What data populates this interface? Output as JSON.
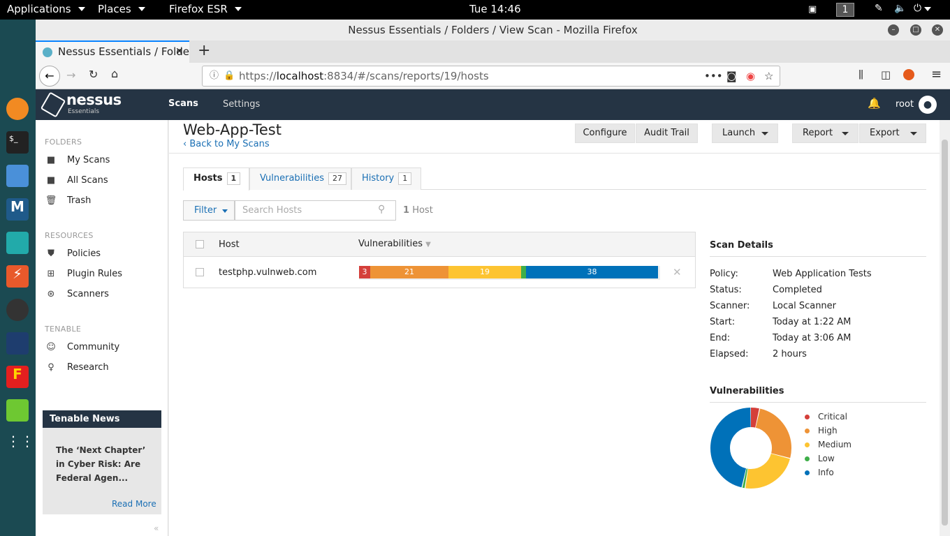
{
  "gnome": {
    "applications": "Applications",
    "places": "Places",
    "browser": "Firefox ESR",
    "clock": "Tue 14:46",
    "workspace": "1"
  },
  "window": {
    "title": "Nessus Essentials / Folders / View Scan - Mozilla Firefox",
    "tab_title": "Nessus Essentials / Folders",
    "url_prefix": "https://",
    "url_host": "localhost",
    "url_rest": ":8834/#/scans/reports/19/hosts"
  },
  "nessus": {
    "logo_text": "nessus",
    "logo_sub": "Essentials",
    "nav_scans": "Scans",
    "nav_settings": "Settings",
    "user": "root"
  },
  "sidebar": {
    "folders_header": "FOLDERS",
    "my_scans": "My Scans",
    "all_scans": "All Scans",
    "trash": "Trash",
    "resources_header": "RESOURCES",
    "policies": "Policies",
    "plugin_rules": "Plugin Rules",
    "scanners": "Scanners",
    "tenable_header": "TENABLE",
    "community": "Community",
    "research": "Research",
    "news_title": "Tenable News",
    "news_body": "The ‘Next Chapter’ in Cyber Risk: Are Federal Agen...",
    "read_more": "Read More"
  },
  "scan": {
    "title": "Web-App-Test",
    "back": "Back to My Scans",
    "configure": "Configure",
    "audit_trail": "Audit Trail",
    "launch": "Launch",
    "report": "Report",
    "export": "Export"
  },
  "tabs": {
    "hosts_label": "Hosts",
    "hosts_count": "1",
    "vulns_label": "Vulnerabilities",
    "vulns_count": "27",
    "history_label": "History",
    "history_count": "1"
  },
  "filter": {
    "label": "Filter",
    "search_placeholder": "Search Hosts",
    "host_count": "1",
    "host_count_label": "Host"
  },
  "table": {
    "col_host": "Host",
    "col_vulns": "Vulnerabilities",
    "rows": [
      {
        "host": "testphp.vulnweb.com",
        "critical": "3",
        "high": "21",
        "medium": "19",
        "low": "",
        "info": "38"
      }
    ]
  },
  "details": {
    "header": "Scan Details",
    "policy_label": "Policy:",
    "policy": "Web Application Tests",
    "status_label": "Status:",
    "status": "Completed",
    "scanner_label": "Scanner:",
    "scanner": "Local Scanner",
    "start_label": "Start:",
    "start": "Today at 1:22 AM",
    "end_label": "End:",
    "end": "Today at 3:06 AM",
    "elapsed_label": "Elapsed:",
    "elapsed": "2 hours"
  },
  "vuln_chart": {
    "header": "Vulnerabilities",
    "legend": [
      "Critical",
      "High",
      "Medium",
      "Low",
      "Info"
    ],
    "colors": [
      "#d43f3a",
      "#ee9336",
      "#fdc431",
      "#3fae49",
      "#0071b9"
    ]
  },
  "chart_data": {
    "type": "pie",
    "categories": [
      "Critical",
      "High",
      "Medium",
      "Low",
      "Info"
    ],
    "values": [
      3,
      21,
      19,
      1,
      38
    ]
  }
}
